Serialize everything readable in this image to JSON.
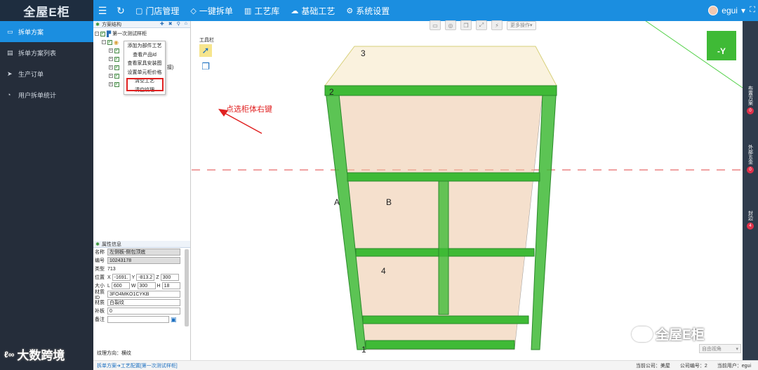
{
  "app": {
    "logo": "全屋E柜"
  },
  "topnav": {
    "items": [
      {
        "label": "门店管理"
      },
      {
        "label": "一键拆单"
      },
      {
        "label": "工艺库"
      },
      {
        "label": "基础工艺"
      },
      {
        "label": "系统设置"
      }
    ],
    "user": "egui"
  },
  "sidebar": {
    "items": [
      {
        "label": "拆单方案"
      },
      {
        "label": "拆单方案列表"
      },
      {
        "label": "生产订单"
      },
      {
        "label": "用户拆单统计"
      }
    ]
  },
  "tree_panel": {
    "title": "方案结构",
    "root": "第一次测试样柜",
    "visible_suffix": "接)"
  },
  "context_menu": {
    "items": [
      {
        "label": "添加为部件工艺"
      },
      {
        "label": "查看产品Id"
      },
      {
        "label": "查看家具安装图"
      },
      {
        "label": "设置单元柜价格"
      },
      {
        "label": "清空工艺"
      },
      {
        "label": "清空纹理"
      }
    ]
  },
  "annotation": "点选柜体右键",
  "props": {
    "title": "属性信息",
    "name_label": "名称",
    "name": "左侧板-侧包顶底",
    "code_label": "编号",
    "code": "10243178",
    "type_label": "类型",
    "type": "713",
    "pos_label": "位置",
    "pos_x": "-1691.",
    "pos_y": "-813.2",
    "pos_z": "300",
    "size_label": "大小",
    "size_l": "600",
    "size_w": "300",
    "size_h": "18",
    "mat_id_label": "材质ID",
    "mat_id": "3FO4MKO1CYKB",
    "mat_label": "材质",
    "mat": "白裂纹",
    "edge_label": "补板",
    "edge": "0",
    "note_label": "备注",
    "note": "",
    "grain": "纹理方向：横纹"
  },
  "toolbar": {
    "label": "工具栏",
    "more": "更多操作"
  },
  "viewcube": {
    "label": "-Y"
  },
  "rightbar": {
    "items": [
      {
        "label": "布置方案",
        "count": "0"
      },
      {
        "label": "外部五金",
        "count": "0"
      },
      {
        "label": "封边",
        "count": "4"
      }
    ]
  },
  "markers": [
    "3",
    "2",
    "A",
    "B",
    "4",
    "1"
  ],
  "view_select": "自由视角",
  "footer": {
    "crumb": "拆单方案➔工艺配置[第一次测试样柜]",
    "company": "当前公司：美屋",
    "company_no": "公司编号：2",
    "user": "当前用户：egui"
  },
  "watermarks": {
    "brand": "全屋E柜",
    "source": "大数跨境"
  },
  "colors": {
    "accent": "#1b8ee0",
    "sidebar": "#252d3a",
    "panel_green": "#3fba36",
    "highlight": "#e02020"
  }
}
